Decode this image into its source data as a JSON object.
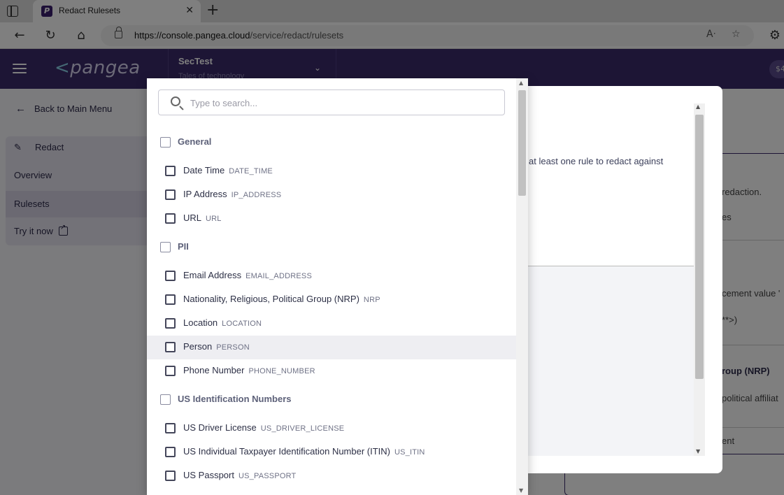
{
  "browser": {
    "tab_title": "Redact Rulesets",
    "tab_favicon_letter": "P",
    "url_host": "https://console.pangea.cloud",
    "url_path": "/service/redact/rulesets"
  },
  "header": {
    "logo_text": "pangea",
    "org_name": "SecTest",
    "org_sub": "Tales of technology",
    "avatar_text": "$4"
  },
  "sidebar": {
    "back_label": "Back to Main Menu",
    "service_label": "Redact",
    "items": [
      {
        "label": "Overview"
      },
      {
        "label": "Rulesets"
      },
      {
        "label": "Try it now"
      }
    ]
  },
  "main": {
    "fragments": [
      "redaction.",
      "es",
      "cement value '",
      "**>)",
      "roup (NRP)",
      "political affiliat",
      "ent"
    ]
  },
  "modal": {
    "text": "at least one rule to redact against"
  },
  "dropdown": {
    "search_placeholder": "Type to search...",
    "options": [
      {
        "label": "General",
        "code": "",
        "group": true
      },
      {
        "label": "Date Time",
        "code": "DATE_TIME",
        "group": false
      },
      {
        "label": "IP Address",
        "code": "IP_ADDRESS",
        "group": false
      },
      {
        "label": "URL",
        "code": "URL",
        "group": false
      },
      {
        "label": "PII",
        "code": "",
        "group": true
      },
      {
        "label": "Email Address",
        "code": "EMAIL_ADDRESS",
        "group": false
      },
      {
        "label": "Nationality, Religious, Political Group (NRP)",
        "code": "NRP",
        "group": false
      },
      {
        "label": "Location",
        "code": "LOCATION",
        "group": false
      },
      {
        "label": "Person",
        "code": "PERSON",
        "group": false
      },
      {
        "label": "Phone Number",
        "code": "PHONE_NUMBER",
        "group": false
      },
      {
        "label": "US Identification Numbers",
        "code": "",
        "group": true
      },
      {
        "label": "US Driver License",
        "code": "US_DRIVER_LICENSE",
        "group": false
      },
      {
        "label": "US Individual Taxpayer Identification Number (ITIN)",
        "code": "US_ITIN",
        "group": false
      },
      {
        "label": "US Passport",
        "code": "US_PASSPORT",
        "group": false
      }
    ]
  },
  "colors": {
    "header_bg": "#3b2b6a",
    "accent": "#3b2b6a",
    "hover_row": "#eeeef2"
  }
}
